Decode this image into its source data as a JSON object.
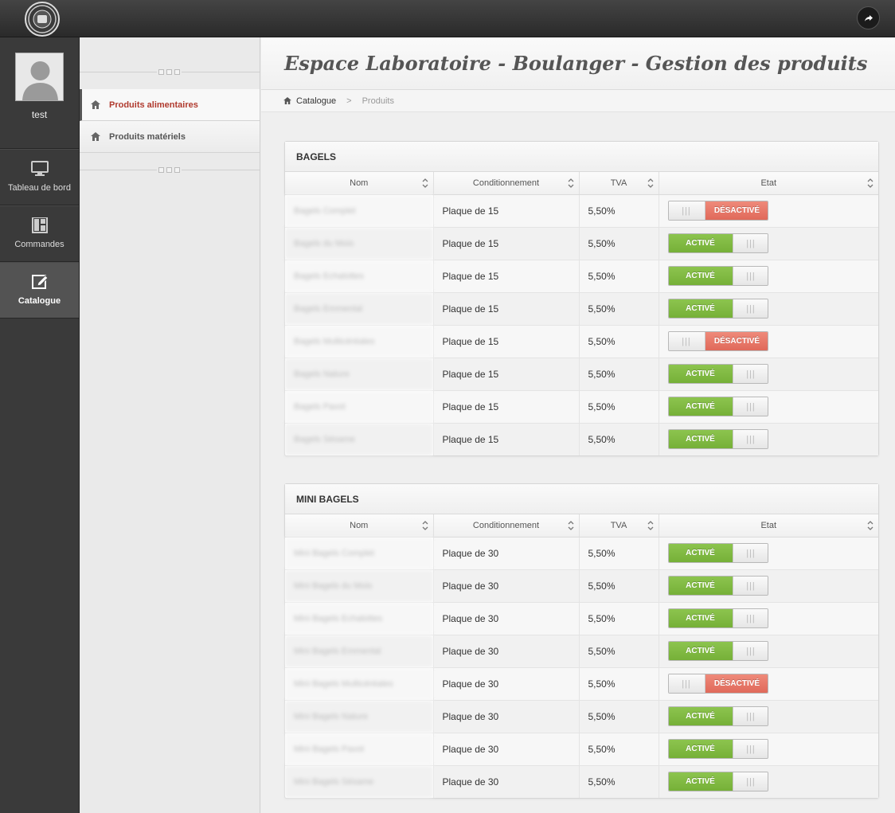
{
  "app": {
    "page_title": "Espace Laboratoire - Boulanger - Gestion des produits"
  },
  "user": {
    "name": "test"
  },
  "sidebar": {
    "items": [
      {
        "label": "Tableau de bord",
        "icon": "monitor-icon",
        "active": false
      },
      {
        "label": "Commandes",
        "icon": "layout-grid-icon",
        "active": false
      },
      {
        "label": "Catalogue",
        "icon": "edit-icon",
        "active": true
      }
    ]
  },
  "subnav": {
    "items": [
      {
        "label": "Produits alimentaires",
        "active": true
      },
      {
        "label": "Produits matériels",
        "active": false
      }
    ]
  },
  "breadcrumb": {
    "root": "Catalogue",
    "separator": ">",
    "current": "Produits"
  },
  "columns": [
    "Nom",
    "Conditionnement",
    "TVA",
    "Etat"
  ],
  "states": {
    "on": "ACTIVÉ",
    "off": "DÉSACTIVÉ"
  },
  "colors": {
    "active": "#7fb843",
    "inactive": "#e87566",
    "link_active": "#b03a2e"
  },
  "panels": [
    {
      "title": "BAGELS",
      "rows": [
        {
          "name": "Bagels Complet",
          "pack": "Plaque de 15",
          "tva": "5,50%",
          "active": false
        },
        {
          "name": "Bagels du Mois",
          "pack": "Plaque de 15",
          "tva": "5,50%",
          "active": true
        },
        {
          "name": "Bagels Echalottes",
          "pack": "Plaque de 15",
          "tva": "5,50%",
          "active": true
        },
        {
          "name": "Bagels Emmental",
          "pack": "Plaque de 15",
          "tva": "5,50%",
          "active": true
        },
        {
          "name": "Bagels Multicéréales",
          "pack": "Plaque de 15",
          "tva": "5,50%",
          "active": false
        },
        {
          "name": "Bagels Nature",
          "pack": "Plaque de 15",
          "tva": "5,50%",
          "active": true
        },
        {
          "name": "Bagels Pavot",
          "pack": "Plaque de 15",
          "tva": "5,50%",
          "active": true
        },
        {
          "name": "Bagels Sésame",
          "pack": "Plaque de 15",
          "tva": "5,50%",
          "active": true
        }
      ]
    },
    {
      "title": "MINI BAGELS",
      "rows": [
        {
          "name": "Mini Bagels Complet",
          "pack": "Plaque de 30",
          "tva": "5,50%",
          "active": true
        },
        {
          "name": "Mini Bagels du Mois",
          "pack": "Plaque de 30",
          "tva": "5,50%",
          "active": true
        },
        {
          "name": "Mini Bagels Echalottes",
          "pack": "Plaque de 30",
          "tva": "5,50%",
          "active": true
        },
        {
          "name": "Mini Bagels Emmental",
          "pack": "Plaque de 30",
          "tva": "5,50%",
          "active": true
        },
        {
          "name": "Mini Bagels Multicéréales",
          "pack": "Plaque de 30",
          "tva": "5,50%",
          "active": false
        },
        {
          "name": "Mini Bagels Nature",
          "pack": "Plaque de 30",
          "tva": "5,50%",
          "active": true
        },
        {
          "name": "Mini Bagels Pavot",
          "pack": "Plaque de 30",
          "tva": "5,50%",
          "active": true
        },
        {
          "name": "Mini Bagels Sésame",
          "pack": "Plaque de 30",
          "tva": "5,50%",
          "active": true
        }
      ]
    }
  ]
}
